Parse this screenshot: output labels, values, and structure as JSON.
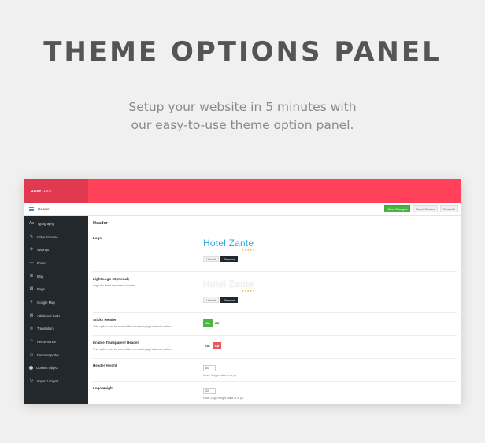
{
  "hero": {
    "title": "THEME OPTIONS PANEL",
    "subtitle_line1": "Setup your website in 5 minutes with",
    "subtitle_line2": "our easy-to-use  theme option panel."
  },
  "panel": {
    "brand": "Zante",
    "version": "1.0.0",
    "breadcrumb": "Header",
    "toolbar": {
      "save": "Save Changes",
      "reset_section": "Reset Section",
      "reset_all": "Reset All"
    },
    "sidebar": [
      {
        "label": "Typography",
        "icon": "typography-icon"
      },
      {
        "label": "Color Scheme",
        "icon": "pencil-icon"
      },
      {
        "label": "Settings",
        "icon": "gear-icon"
      },
      {
        "label": "Footer",
        "icon": "minus-icon"
      },
      {
        "label": "Blog",
        "icon": "list-icon"
      },
      {
        "label": "Page",
        "icon": "page-icon"
      },
      {
        "label": "Google Map",
        "icon": "map-pin-icon"
      },
      {
        "label": "Additional Code",
        "icon": "code-icon"
      },
      {
        "label": "Translation",
        "icon": "globe-icon"
      },
      {
        "label": "Performance",
        "icon": "gauge-icon"
      },
      {
        "label": "Demo Importer",
        "icon": "import-icon"
      },
      {
        "label": "Options Object",
        "icon": "info-icon"
      },
      {
        "label": "Import / Export",
        "icon": "refresh-icon"
      }
    ],
    "section_title": "Header",
    "logo": {
      "label": "Logo",
      "logo_text": "Hotel Zante",
      "stars": "★★★★★",
      "upload": "Upload",
      "remove": "Remove"
    },
    "light_logo": {
      "label": "Light Logo (Optional)",
      "desc": "Logo for the transparent header.",
      "logo_text": "Hotel Zante",
      "stars": "★★★★★",
      "upload": "Upload",
      "remove": "Remove"
    },
    "sticky_header": {
      "label": "Sticky Header",
      "desc": "This option can be overridden on each page's layout option.",
      "on": "On",
      "off": "Off",
      "state": "on"
    },
    "transparent_header": {
      "label": "Enable Transparent Header",
      "desc": "This option can be overridden on each page's layout option.",
      "on": "On",
      "off": "Off",
      "state": "off"
    },
    "header_height": {
      "label": "Header Height",
      "value": "80",
      "note": "Note: Height value is in px."
    },
    "logo_height": {
      "label": "Logo Height",
      "value": "32",
      "note": "Note: Logo Height value is in px."
    },
    "colors": {
      "accent": "#ff4159",
      "sidebar": "#23282d",
      "on": "#4bb543",
      "off": "#e95a5e"
    }
  }
}
